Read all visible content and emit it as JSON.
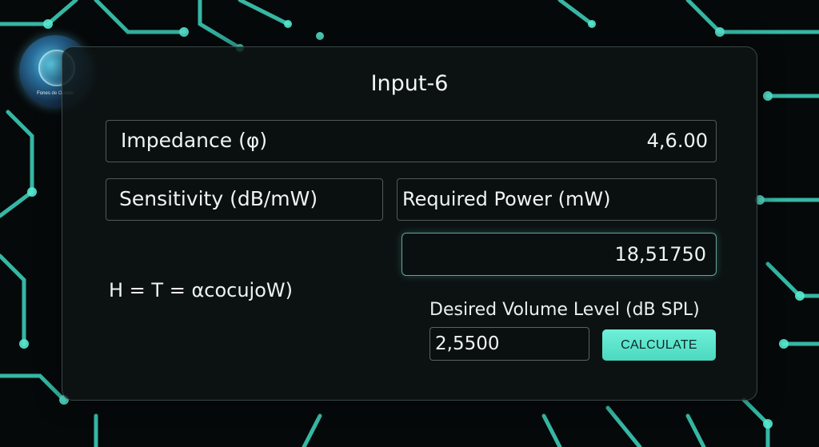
{
  "logo": {
    "caption": "Fones de Ouvido"
  },
  "window": {
    "title": "Input-6"
  },
  "impedance": {
    "label": "Impedance (φ)",
    "value": "4,6.00"
  },
  "sensitivity": {
    "label": "Sensitivity (dB/mW)"
  },
  "required_power": {
    "label": "Required Power (mW)",
    "value": "18,51750"
  },
  "formula": {
    "text": "H = T = αcocujoW)"
  },
  "desired_volume": {
    "label": "Desired Volume Level (dB SPL)",
    "value": "2,5500"
  },
  "calculate_button": {
    "label": "CALCULATE"
  },
  "colors": {
    "accent": "#5ce6cc",
    "background": "#06090a",
    "panel": "#0e1414"
  }
}
